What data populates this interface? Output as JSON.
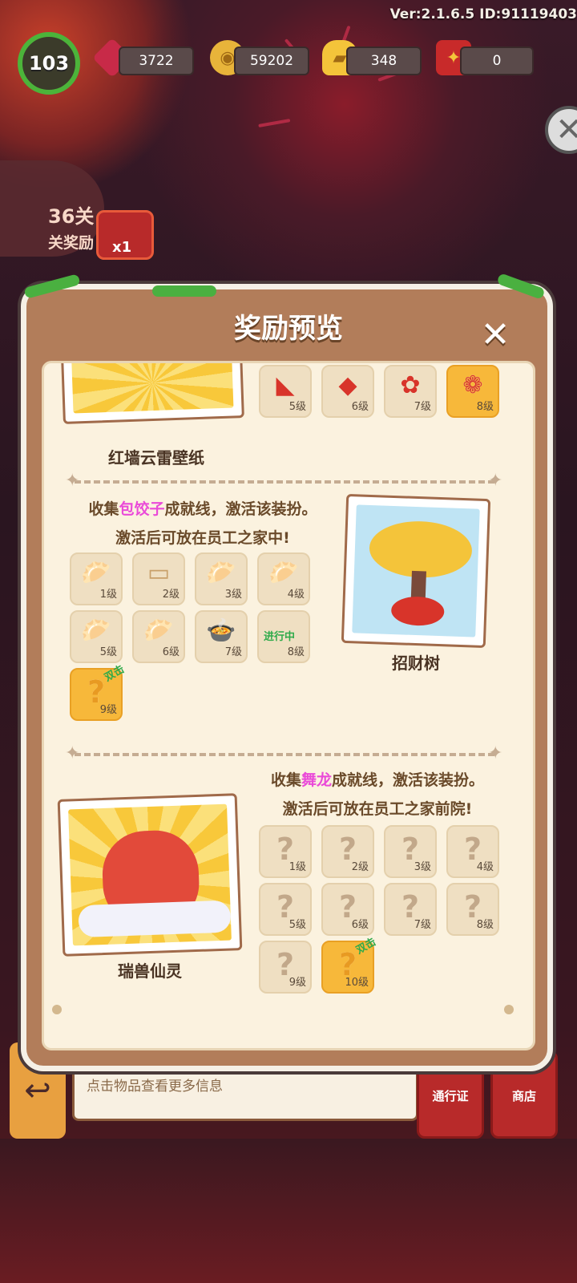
{
  "header": {
    "version": "Ver:2.1.6.5 ID:91119403",
    "level": "103",
    "resources": [
      {
        "name": "gem",
        "icon": "gem-icon",
        "value": "3722"
      },
      {
        "name": "coin",
        "icon": "coin-icon",
        "value": "59202"
      },
      {
        "name": "gold-ingot",
        "icon": "ingot-icon",
        "value": "348"
      },
      {
        "name": "red-envelope",
        "icon": "gift-icon",
        "value": "0"
      }
    ]
  },
  "background": {
    "stage_label": "36关",
    "stage_reward_label": "关奖励",
    "reward_count": "x1"
  },
  "panel": {
    "title": "奖励预览",
    "close_icon": "close-icon",
    "sections": [
      {
        "caption": "红墙云雷壁纸",
        "items": [
          {
            "level": "5级"
          },
          {
            "level": "6级"
          },
          {
            "level": "7级"
          },
          {
            "level": "8级"
          }
        ]
      },
      {
        "desc_prefix": "收集",
        "desc_highlight": "包饺子",
        "desc_suffix": "成就线，激活该装扮。",
        "desc_line2": "激活后可放在员工之家中!",
        "caption": "招财树",
        "progress_tag": "进行中",
        "double_tag": "双击",
        "items": [
          {
            "level": "1级"
          },
          {
            "level": "2级"
          },
          {
            "level": "3级"
          },
          {
            "level": "4级"
          },
          {
            "level": "5级"
          },
          {
            "level": "6级"
          },
          {
            "level": "7级"
          },
          {
            "level": "8级"
          },
          {
            "level": "9级"
          }
        ]
      },
      {
        "desc_prefix": "收集",
        "desc_highlight": "舞龙",
        "desc_suffix": "成就线，激活该装扮。",
        "desc_line2": "激活后可放在员工之家前院!",
        "caption": "瑞兽仙灵",
        "double_tag": "双击",
        "items": [
          {
            "level": "1级"
          },
          {
            "level": "2级"
          },
          {
            "level": "3级"
          },
          {
            "level": "4级"
          },
          {
            "level": "5级"
          },
          {
            "level": "6级"
          },
          {
            "level": "7级"
          },
          {
            "level": "8级"
          },
          {
            "level": "9级"
          },
          {
            "level": "10级"
          }
        ]
      }
    ]
  },
  "bottom": {
    "hint": "点击物品查看更多信息",
    "pass_label": "通行证",
    "shop_label": "商店"
  },
  "colors": {
    "panel_border": "#b27d5a",
    "scroll_bg": "#fbf2df",
    "highlight": "#ea4ad8",
    "progress_green": "#2faa4a"
  }
}
